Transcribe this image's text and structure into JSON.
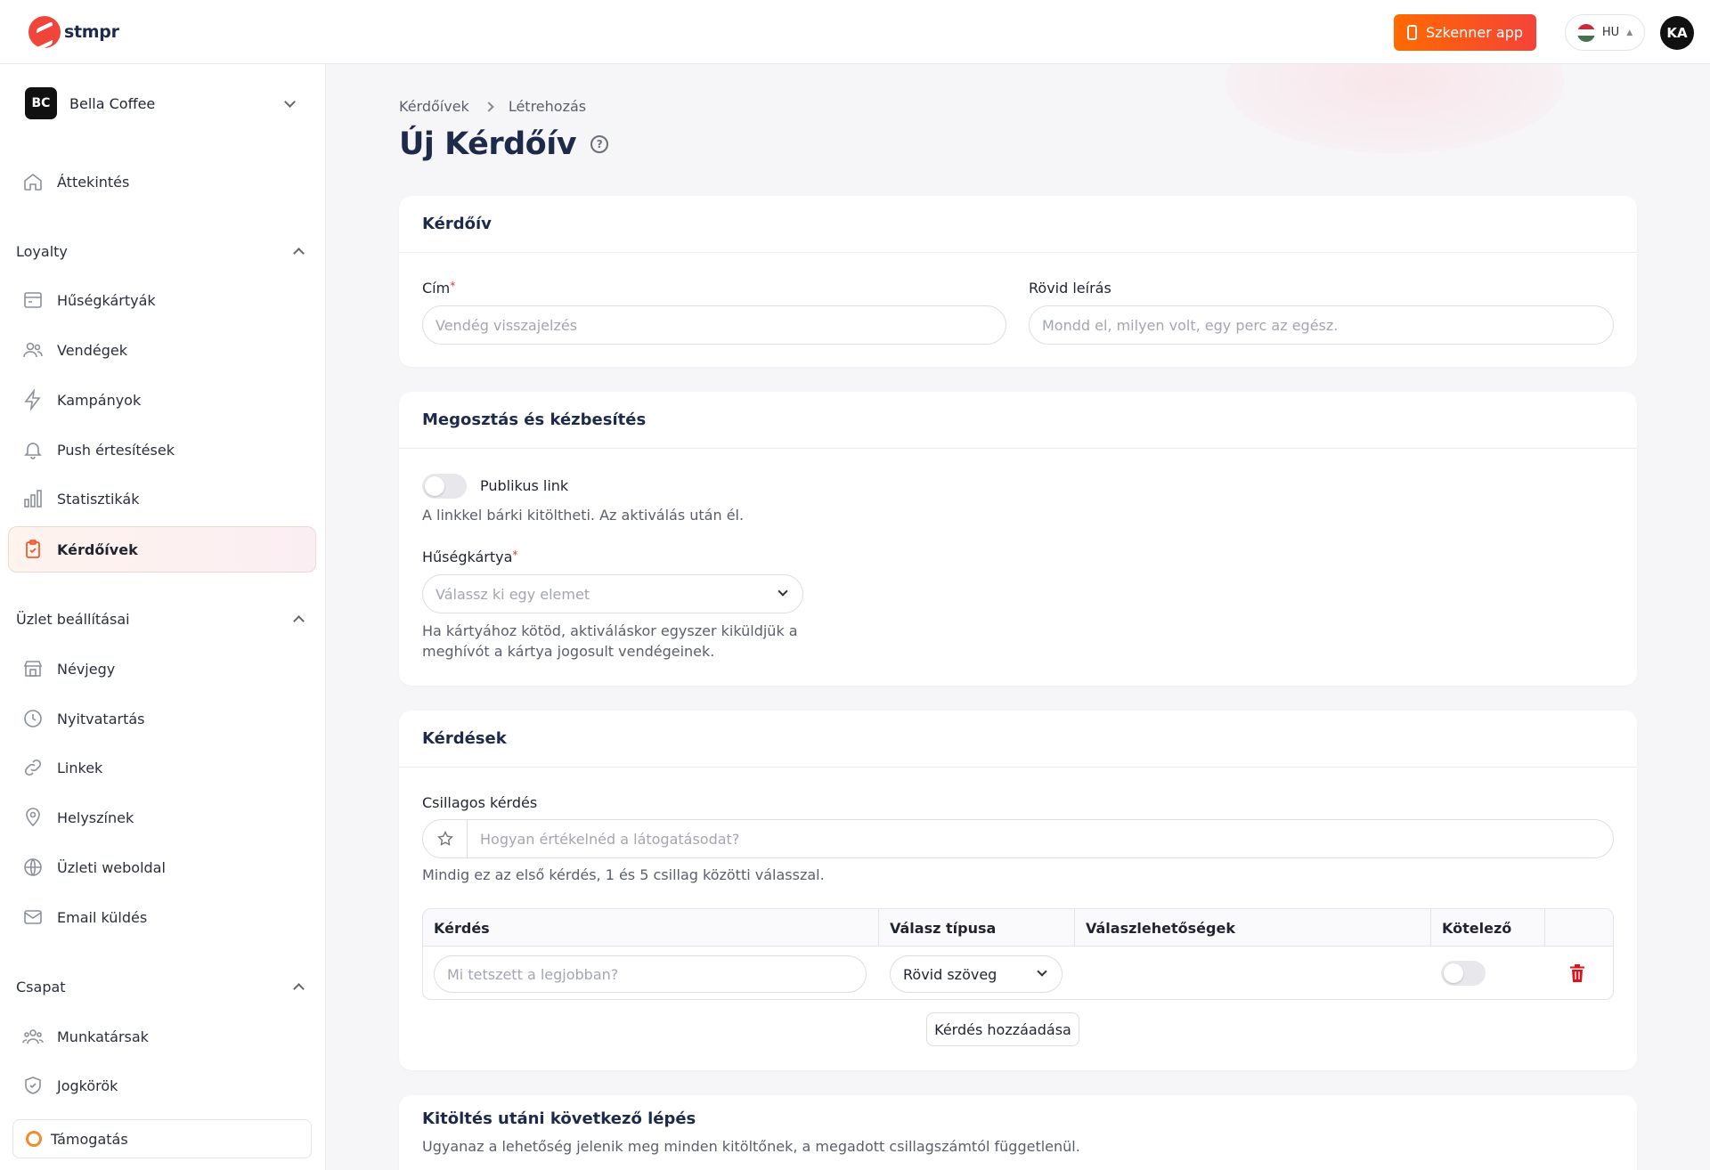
{
  "app": {
    "logo_text": "stmpr",
    "scanner_label": "Szkenner app",
    "language": "HU",
    "user_initials": "KA"
  },
  "colors": {
    "accent": "#f05a2a",
    "brand_gradient_start": "#ff6a00",
    "brand_gradient_end": "#f4433a",
    "title": "#1e2a4a"
  },
  "sidebar": {
    "business": {
      "initials": "BC",
      "name": "Bella Coffee"
    },
    "overview": {
      "label": "Áttekintés",
      "icon": "home-icon"
    },
    "sections": [
      {
        "title": "Loyalty",
        "items": [
          {
            "label": "Hűségkártyák",
            "icon": "card-icon"
          },
          {
            "label": "Vendégek",
            "icon": "users-icon"
          },
          {
            "label": "Kampányok",
            "icon": "bolt-icon"
          },
          {
            "label": "Push értesítések",
            "icon": "bell-icon"
          },
          {
            "label": "Statisztikák",
            "icon": "bar-chart-icon"
          },
          {
            "label": "Kérdőívek",
            "icon": "clipboard-icon",
            "active": true
          }
        ]
      },
      {
        "title": "Üzlet beállításai",
        "items": [
          {
            "label": "Névjegy",
            "icon": "store-icon"
          },
          {
            "label": "Nyitvatartás",
            "icon": "clock-icon"
          },
          {
            "label": "Linkek",
            "icon": "link-icon"
          },
          {
            "label": "Helyszínek",
            "icon": "pin-icon"
          },
          {
            "label": "Üzleti weboldal",
            "icon": "globe-icon"
          },
          {
            "label": "Email küldés",
            "icon": "mail-icon"
          }
        ]
      },
      {
        "title": "Csapat",
        "items": [
          {
            "label": "Munkatársak",
            "icon": "team-icon"
          },
          {
            "label": "Jogkörök",
            "icon": "shield-icon"
          }
        ]
      }
    ],
    "support_label": "Támogatás"
  },
  "main": {
    "breadcrumb": [
      "Kérdőívek",
      "Létrehozás"
    ],
    "title": "Új Kérdőív",
    "survey_card": {
      "header": "Kérdőív",
      "title_label": "Cím",
      "title_placeholder": "Vendég visszajelzés",
      "desc_label": "Rövid leírás",
      "desc_placeholder": "Mondd el, milyen volt, egy perc az egész."
    },
    "sharing_card": {
      "header": "Megosztás és kézbesítés",
      "public_link_label": "Publikus link",
      "public_link_hint": "A linkkel bárki kitöltheti. Az aktiválás után él.",
      "loyalty_label": "Hűségkártya",
      "loyalty_placeholder": "Válassz ki egy elemet",
      "loyalty_hint_1": "Ha kártyához kötöd, aktiváláskor egyszer kiküldjük a",
      "loyalty_hint_2": "meghívót a kártya jogosult vendégeinek."
    },
    "questions_card": {
      "header": "Kérdések",
      "star_label": "Csillagos kérdés",
      "star_placeholder": "Hogyan értékelnéd a látogatásodat?",
      "star_hint": "Mindig ez az első kérdés, 1 és 5 csillag közötti válasszal.",
      "columns": [
        "Kérdés",
        "Válasz típusa",
        "Válaszlehetőségek",
        "Kötelező"
      ],
      "row": {
        "question_placeholder": "Mi tetszett a legjobban?",
        "type_value": "Rövid szöveg"
      },
      "add_label": "Kérdés hozzáadása"
    },
    "next_step_card": {
      "header": "Kitöltés utáni következő lépés",
      "hint": "Ugyanaz a lehetőség jelenik meg minden kitöltőnek, a megadott csillagszámtól függetlenül."
    }
  }
}
